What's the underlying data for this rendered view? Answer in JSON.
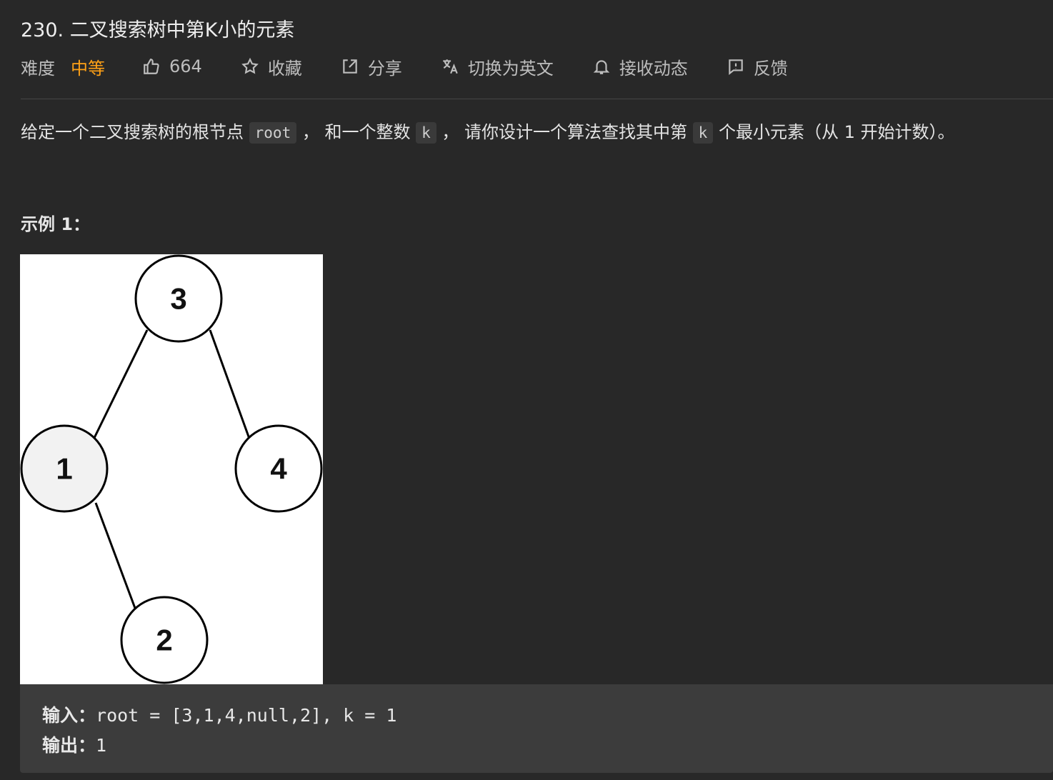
{
  "problem": {
    "title": "230. 二叉搜索树中第K小的元素"
  },
  "meta": {
    "difficulty_label": "难度",
    "difficulty": "中等",
    "likes": "664",
    "favorite": "收藏",
    "share": "分享",
    "switch_lang": "切换为英文",
    "subscribe": "接收动态",
    "feedback": "反馈"
  },
  "description": {
    "part1": "给定一个二叉搜索树的根节点 ",
    "code1": "root",
    "part2": " ， 和一个整数 ",
    "code2": "k",
    "part3": " ， 请你设计一个算法查找其中第 ",
    "code3": "k",
    "part4": " 个最小元素（从 1 开始计数）。"
  },
  "example": {
    "title": "示例 1：",
    "tree_nodes": [
      "3",
      "1",
      "4",
      "2"
    ],
    "input_key": "输入：",
    "input_value": "root = [3,1,4,null,2], k = 1",
    "output_key": "输出：",
    "output_value": "1"
  },
  "colors": {
    "background": "#282828",
    "difficulty_medium": "#ffa116",
    "code_bg": "#3a3a3a"
  }
}
